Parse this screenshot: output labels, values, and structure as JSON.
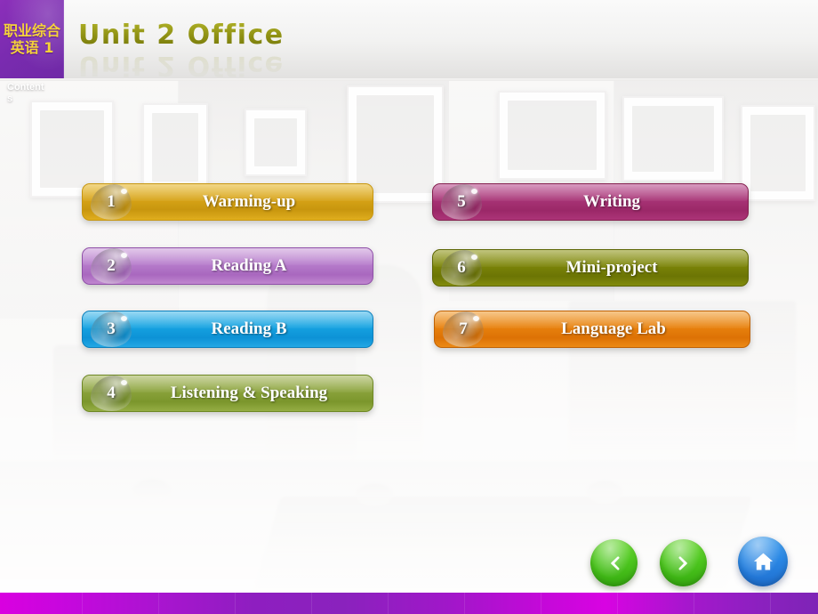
{
  "header": {
    "logo_line1": "职业综合",
    "logo_line2": "英语 1",
    "title": "Unit 2  Office"
  },
  "sidebar": {
    "contents_label": "Contents"
  },
  "menu": {
    "left_column": [
      {
        "number": "1",
        "label": "Warming-up",
        "color": "#d8a417"
      },
      {
        "number": "2",
        "label": "Reading A",
        "color": "#b87fcd"
      },
      {
        "number": "3",
        "label": "Reading B",
        "color": "#16a4e2"
      },
      {
        "number": "4",
        "label": "Listening & Speaking",
        "color": "#8ba33c"
      }
    ],
    "right_column": [
      {
        "number": "5",
        "label": "Writing",
        "color": "#a83476"
      },
      {
        "number": "6",
        "label": "Mini-project",
        "color": "#7b8408"
      },
      {
        "number": "7",
        "label": "Language Lab",
        "color": "#e8820e"
      }
    ]
  },
  "navigation": {
    "previous": {
      "icon": "chevron-left-icon",
      "color": "#4ec71f"
    },
    "next": {
      "icon": "chevron-right-icon",
      "color": "#4ec71f"
    },
    "home": {
      "icon": "home-icon",
      "color": "#2a87e4"
    }
  },
  "theme": {
    "logo_background": "#7a2bb0",
    "title_color": "#8b8f14",
    "header_background": "#f2f2f1",
    "bottom_bar_start": "#d900e0",
    "bottom_bar_end": "#7e24b6"
  }
}
